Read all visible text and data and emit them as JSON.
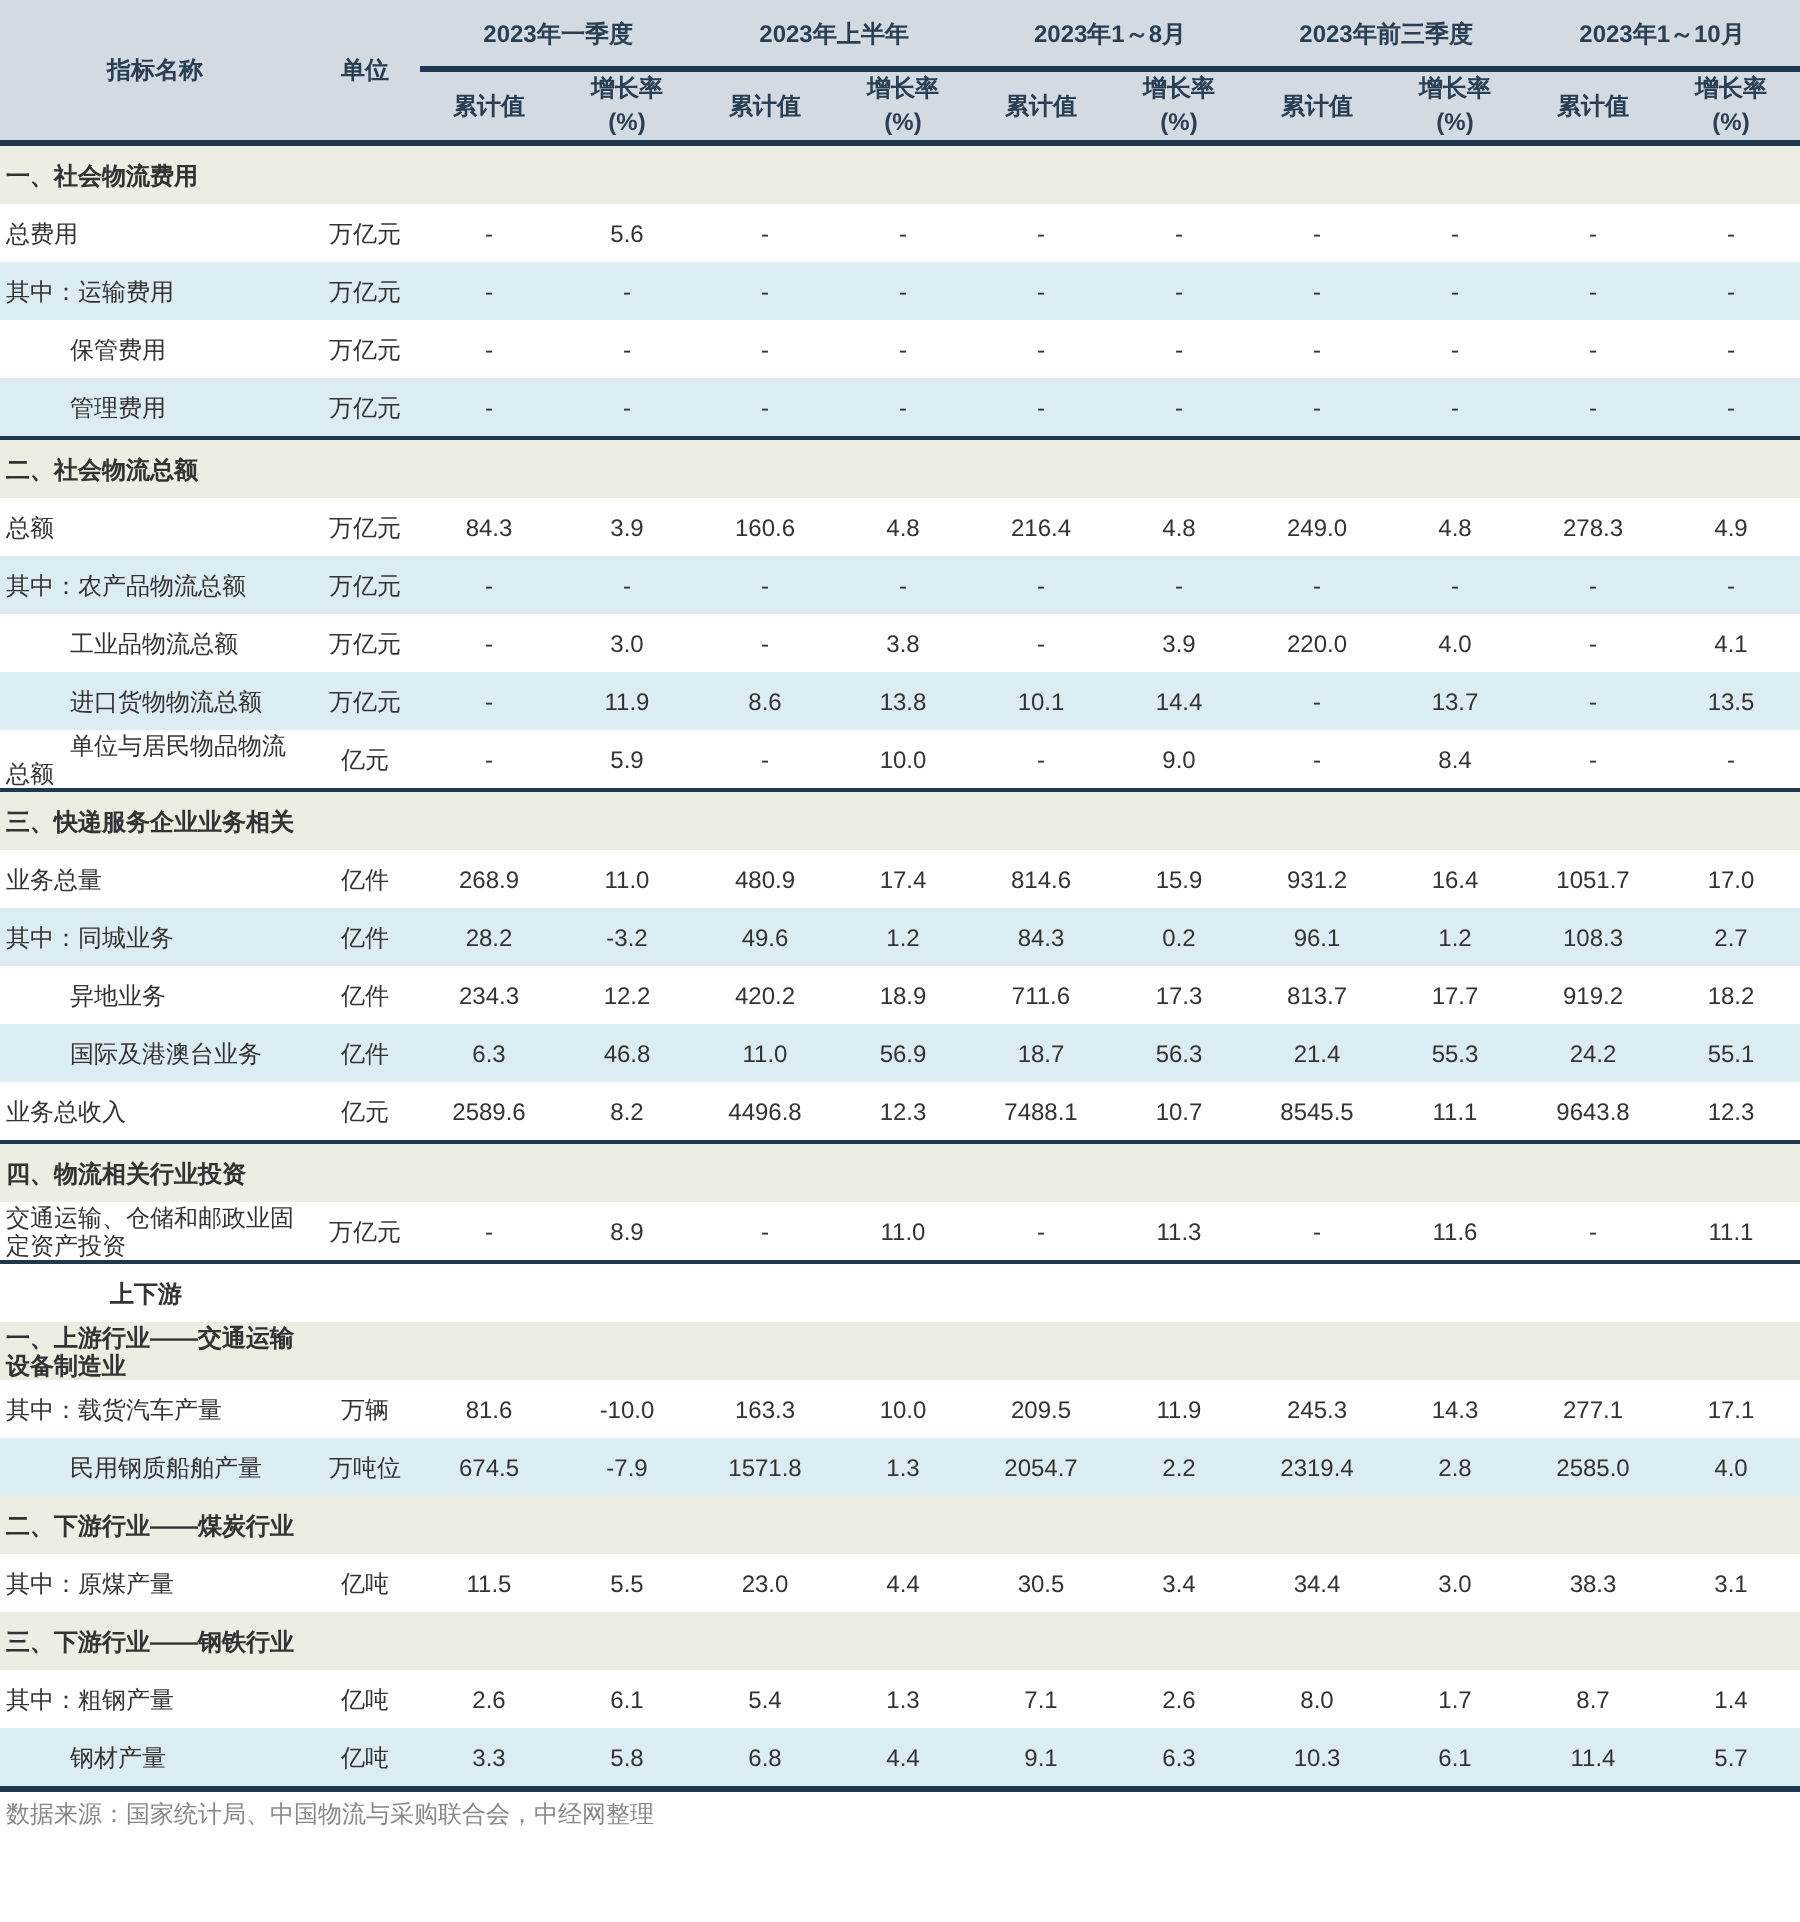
{
  "table": {
    "columns": [
      {
        "label": "指标名称"
      },
      {
        "label": "单位"
      }
    ],
    "periods": [
      {
        "label": "2023年一季度",
        "subcolumns": [
          {
            "label": "累计值"
          },
          {
            "label": "增长率",
            "unit": "(%)"
          }
        ]
      },
      {
        "label": "2023年上半年",
        "subcolumns": [
          {
            "label": "累计值"
          },
          {
            "label": "增长率",
            "unit": "(%)"
          }
        ]
      },
      {
        "label": "2023年1～8月",
        "subcolumns": [
          {
            "label": "累计值"
          },
          {
            "label": "增长率",
            "unit": "(%)"
          }
        ]
      },
      {
        "label": "2023年前三季度",
        "subcolumns": [
          {
            "label": "累计值"
          },
          {
            "label": "增长率",
            "unit": "(%)"
          }
        ]
      },
      {
        "label": "2023年1～10月",
        "subcolumns": [
          {
            "label": "累计值"
          },
          {
            "label": "增长率",
            "unit": "(%)"
          }
        ]
      }
    ],
    "groups": [
      {
        "rows": [
          {
            "kind": "section",
            "label": "一、社会物流费用"
          },
          {
            "kind": "item",
            "label": "总费用",
            "unit": "万亿元",
            "values": [
              "-",
              "5.6",
              "-",
              "-",
              "-",
              "-",
              "-",
              "-",
              "-",
              "-"
            ]
          },
          {
            "kind": "item",
            "label": "其中：运输费用",
            "unit": "万亿元",
            "values": [
              "-",
              "-",
              "-",
              "-",
              "-",
              "-",
              "-",
              "-",
              "-",
              "-"
            ]
          },
          {
            "kind": "sub",
            "label": "保管费用",
            "unit": "万亿元",
            "values": [
              "-",
              "-",
              "-",
              "-",
              "-",
              "-",
              "-",
              "-",
              "-",
              "-"
            ]
          },
          {
            "kind": "sub",
            "label": "管理费用",
            "unit": "万亿元",
            "values": [
              "-",
              "-",
              "-",
              "-",
              "-",
              "-",
              "-",
              "-",
              "-",
              "-"
            ]
          }
        ]
      },
      {
        "rows": [
          {
            "kind": "section",
            "label": "二、社会物流总额"
          },
          {
            "kind": "item",
            "label": "总额",
            "unit": "万亿元",
            "values": [
              "84.3",
              "3.9",
              "160.6",
              "4.8",
              "216.4",
              "4.8",
              "249.0",
              "4.8",
              "278.3",
              "4.9"
            ]
          },
          {
            "kind": "item",
            "label": "其中：农产品物流总额",
            "unit": "万亿元",
            "values": [
              "-",
              "-",
              "-",
              "-",
              "-",
              "-",
              "-",
              "-",
              "-",
              "-"
            ]
          },
          {
            "kind": "sub",
            "label": "工业品物流总额",
            "unit": "万亿元",
            "values": [
              "-",
              "3.0",
              "-",
              "3.8",
              "-",
              "3.9",
              "220.0",
              "4.0",
              "-",
              "4.1"
            ]
          },
          {
            "kind": "sub",
            "label": "进口货物物流总额",
            "unit": "万亿元",
            "values": [
              "-",
              "11.9",
              "8.6",
              "13.8",
              "10.1",
              "14.4",
              "-",
              "13.7",
              "-",
              "13.5"
            ]
          },
          {
            "kind": "sub",
            "label": "单位与居民物品物流总额",
            "unit": "亿元",
            "values": [
              "-",
              "5.9",
              "-",
              "10.0",
              "-",
              "9.0",
              "-",
              "8.4",
              "-",
              "-"
            ]
          }
        ]
      },
      {
        "rows": [
          {
            "kind": "section",
            "label": "三、快递服务企业业务相关"
          },
          {
            "kind": "item",
            "label": "业务总量",
            "unit": "亿件",
            "values": [
              "268.9",
              "11.0",
              "480.9",
              "17.4",
              "814.6",
              "15.9",
              "931.2",
              "16.4",
              "1051.7",
              "17.0"
            ]
          },
          {
            "kind": "item",
            "label": "其中：同城业务",
            "unit": "亿件",
            "values": [
              "28.2",
              "-3.2",
              "49.6",
              "1.2",
              "84.3",
              "0.2",
              "96.1",
              "1.2",
              "108.3",
              "2.7"
            ]
          },
          {
            "kind": "sub",
            "label": "异地业务",
            "unit": "亿件",
            "values": [
              "234.3",
              "12.2",
              "420.2",
              "18.9",
              "711.6",
              "17.3",
              "813.7",
              "17.7",
              "919.2",
              "18.2"
            ]
          },
          {
            "kind": "sub",
            "label": "国际及港澳台业务",
            "unit": "亿件",
            "values": [
              "6.3",
              "46.8",
              "11.0",
              "56.9",
              "18.7",
              "56.3",
              "21.4",
              "55.3",
              "24.2",
              "55.1"
            ]
          },
          {
            "kind": "item",
            "label": "业务总收入",
            "unit": "亿元",
            "values": [
              "2589.6",
              "8.2",
              "4496.8",
              "12.3",
              "7488.1",
              "10.7",
              "8545.5",
              "11.1",
              "9643.8",
              "12.3"
            ]
          }
        ]
      },
      {
        "rows": [
          {
            "kind": "section",
            "label": "四、物流相关行业投资"
          },
          {
            "kind": "item",
            "label": "交通运输、仓储和邮政业固定资产投资",
            "unit": "万亿元",
            "values": [
              "-",
              "8.9",
              "-",
              "11.0",
              "-",
              "11.3",
              "-",
              "11.6",
              "-",
              "11.1"
            ]
          }
        ]
      },
      {
        "rows": [
          {
            "kind": "subhead",
            "label": "上下游"
          },
          {
            "kind": "section",
            "label": "一、上游行业——交通运输设备制造业"
          },
          {
            "kind": "item",
            "label": "其中：载货汽车产量",
            "unit": "万辆",
            "values": [
              "81.6",
              "-10.0",
              "163.3",
              "10.0",
              "209.5",
              "11.9",
              "245.3",
              "14.3",
              "277.1",
              "17.1"
            ]
          },
          {
            "kind": "sub",
            "label": "民用钢质船舶产量",
            "unit": "万吨位",
            "values": [
              "674.5",
              "-7.9",
              "1571.8",
              "1.3",
              "2054.7",
              "2.2",
              "2319.4",
              "2.8",
              "2585.0",
              "4.0"
            ]
          },
          {
            "kind": "section",
            "label": "二、下游行业——煤炭行业"
          },
          {
            "kind": "item",
            "label": "其中：原煤产量",
            "unit": "亿吨",
            "values": [
              "11.5",
              "5.5",
              "23.0",
              "4.4",
              "30.5",
              "3.4",
              "34.4",
              "3.0",
              "38.3",
              "3.1"
            ]
          },
          {
            "kind": "section",
            "label": "三、下游行业——钢铁行业"
          },
          {
            "kind": "item",
            "label": "其中：粗钢产量",
            "unit": "亿吨",
            "values": [
              "2.6",
              "6.1",
              "5.4",
              "1.3",
              "7.1",
              "2.6",
              "8.0",
              "1.7",
              "8.7",
              "1.4"
            ]
          },
          {
            "kind": "sub",
            "label": "钢材产量",
            "unit": "亿吨",
            "values": [
              "3.3",
              "5.8",
              "6.8",
              "4.4",
              "9.1",
              "6.3",
              "10.3",
              "6.1",
              "11.4",
              "5.7"
            ]
          }
        ]
      }
    ]
  },
  "source_note": "数据来源：国家统计局、中国物流与采购联合会，中经网整理"
}
